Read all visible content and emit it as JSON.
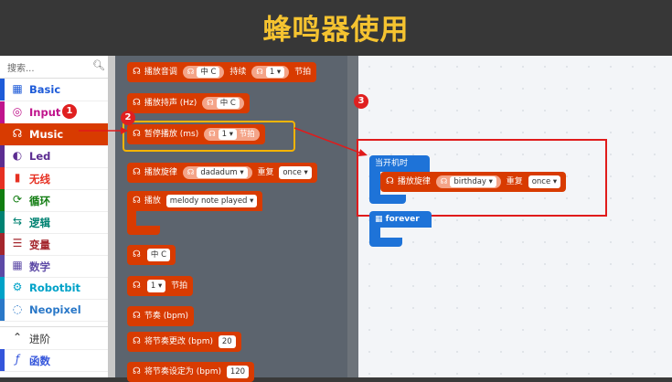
{
  "title": "蜂鸣器使用",
  "search": {
    "placeholder": "搜索...",
    "icon": "search-icon"
  },
  "categories": [
    {
      "label": "Basic",
      "icon": "grid-icon",
      "color": "#1e5bd8"
    },
    {
      "label": "Input",
      "icon": "target-icon",
      "color": "#c0148c"
    },
    {
      "label": "Music",
      "icon": "headphones-icon",
      "color": "#d83b01",
      "selected": true
    },
    {
      "label": "Led",
      "icon": "toggle-icon",
      "color": "#5c2d91"
    },
    {
      "label": "无线",
      "icon": "bars-icon",
      "color": "#e63022"
    },
    {
      "label": "循环",
      "icon": "refresh-icon",
      "color": "#107c10"
    },
    {
      "label": "逻辑",
      "icon": "shuffle-icon",
      "color": "#008272"
    },
    {
      "label": "变量",
      "icon": "list-icon",
      "color": "#a4262c"
    },
    {
      "label": "数学",
      "icon": "calculator-icon",
      "color": "#5d4aa6"
    },
    {
      "label": "Robotbit",
      "icon": "gear-icon",
      "color": "#00a2c8"
    },
    {
      "label": "Neopixel",
      "icon": "spinner-icon",
      "color": "#2a78c8"
    },
    {
      "label": "进阶",
      "icon": "chevron-up-icon",
      "color": "#333333"
    },
    {
      "label": "函数",
      "icon": "function-icon",
      "color": "#3455db"
    }
  ],
  "flyout": {
    "play_tone": {
      "label": "播放音调",
      "note": "中 C",
      "for": "持续",
      "beat": "1",
      "beat_unit": "节拍"
    },
    "ring_tone": {
      "label": "播放持声 (Hz)",
      "note": "中 C"
    },
    "rest": {
      "label": "暂停播放 (ms)",
      "beat": "1",
      "beat_unit": "节拍"
    },
    "start_melody": {
      "label": "播放旋律",
      "melody": "dadadum",
      "repeat": "重复",
      "repeat_value": "once"
    },
    "on_event": {
      "label": "播放",
      "event": "melody note played"
    },
    "note_reporter": {
      "note": "中 C"
    },
    "beat_reporter": {
      "beat": "1",
      "unit": "节拍"
    },
    "tempo_reporter": {
      "label": "节奏 (bpm)"
    },
    "change_tempo": {
      "label": "将节奏更改 (bpm)",
      "value": "20"
    },
    "set_tempo": {
      "label": "将节奏设定为 (bpm)",
      "value": "120"
    }
  },
  "workspace": {
    "on_start": {
      "label": "当开机时"
    },
    "play_melody": {
      "label": "播放旋律",
      "melody": "birthday",
      "repeat": "重复",
      "repeat_value": "once"
    },
    "forever": {
      "label": "forever"
    }
  },
  "annotations": {
    "badge1": "1",
    "badge2": "2",
    "badge3": "3"
  },
  "colors": {
    "music": "#d83b01",
    "title": "#f5c330",
    "highlight": "#e01b1b",
    "basic": "#1e73d8"
  }
}
